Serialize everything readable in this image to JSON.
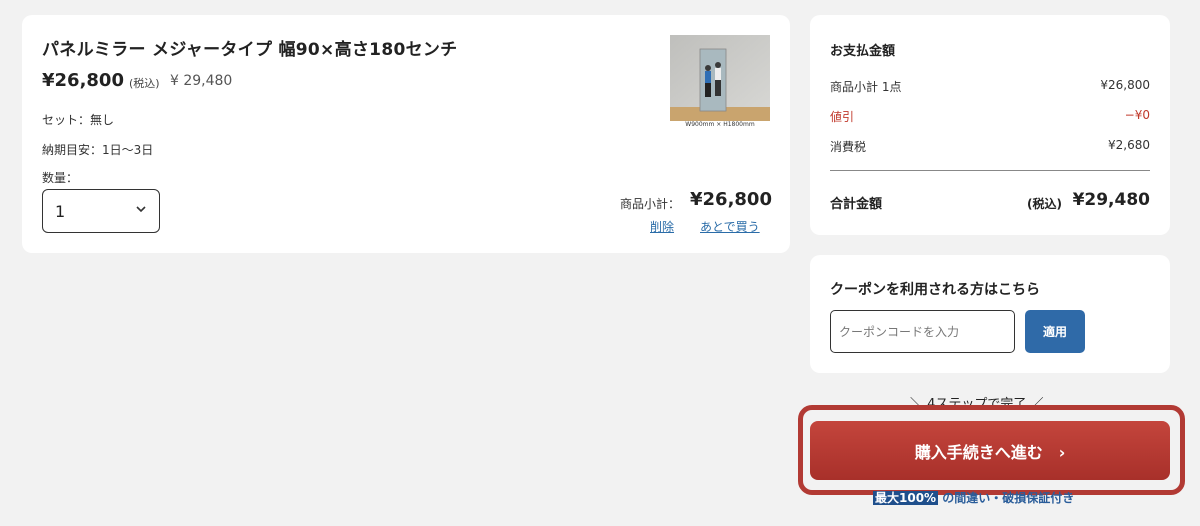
{
  "product": {
    "title": "パネルミラー メジャータイプ 幅90×高さ180センチ",
    "price": "¥26,800",
    "tax_label": "(税込)",
    "tax_price": "¥ 29,480",
    "set": "セット：無し",
    "delivery": "納期目安：1日〜3日",
    "quantity_label": "数量：",
    "quantity_value": "1",
    "image_caption": "W900mm × H1800mm",
    "subtotal_label": "商品小計：",
    "subtotal_value": "¥26,800",
    "delete_label": "削除",
    "buy_later_label": "あとで買う"
  },
  "summary": {
    "title": "お支払金額",
    "rows": [
      {
        "label": "商品小計 1点",
        "value": "¥26,800"
      },
      {
        "label": "値引",
        "value": "−¥0"
      },
      {
        "label": "消費税",
        "value": "¥2,680"
      }
    ],
    "total_label": "合計金額",
    "total_tax_label": "(税込)",
    "total_value": "¥29,480"
  },
  "coupon": {
    "title": "クーポンを利用される方はこちら",
    "placeholder": "クーポンコードを入力",
    "apply_label": "適用"
  },
  "checkout": {
    "steps_text": "4ステップで完了",
    "button_label": "購入手続きへ進む",
    "guarantee_highlight": "最大100%",
    "guarantee_text": "の間違い・破損保証付き"
  },
  "colors": {
    "accent_red": "#b23a34",
    "accent_blue": "#2f6aa8",
    "discount_red": "#c0392b"
  }
}
